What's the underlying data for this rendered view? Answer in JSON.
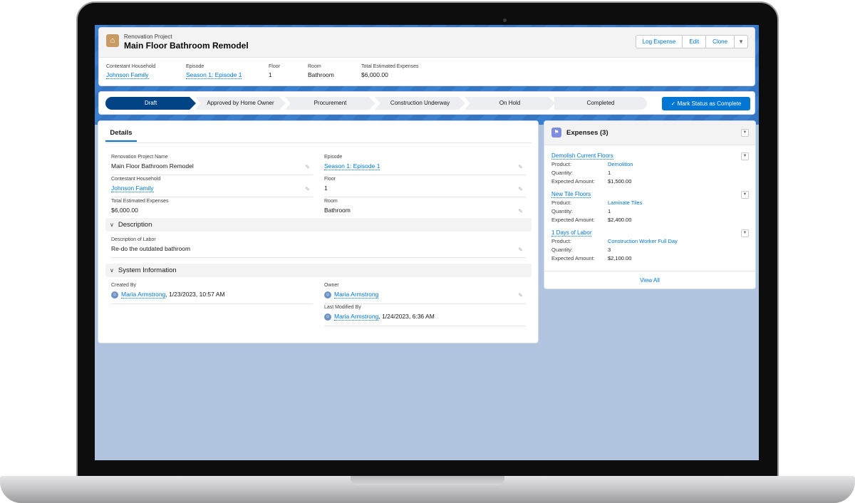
{
  "header": {
    "object_type": "Renovation Project",
    "title": "Main Floor Bathroom Remodel",
    "buttons": [
      "Log Expense",
      "Edit",
      "Clone"
    ],
    "dropdown_icon": "chevron-down-icon",
    "highlights": [
      {
        "label": "Contestant Household",
        "value": "Johnson Family"
      },
      {
        "label": "Episode",
        "value": "Season 1: Episode 1"
      },
      {
        "label": "Floor",
        "value": "1"
      },
      {
        "label": "Room",
        "value": "Bathroom"
      },
      {
        "label": "Total Estimated Expenses",
        "value": "$6,000.00"
      }
    ]
  },
  "path": {
    "stages": [
      "Draft",
      "Approved by Home Owner",
      "Procurement",
      "Construction Underway",
      "On Hold",
      "Completed"
    ],
    "active": "Draft",
    "action_label": "Mark Status as Complete"
  },
  "details": {
    "tab": "Details",
    "fields": [
      {
        "label": "Renovation Project Name",
        "value": "Main Floor Bathroom Remodel"
      },
      {
        "label": "Episode",
        "value": "Season 1: Episode 1"
      },
      {
        "label": "Contestant Household",
        "value": "Johnson Family"
      },
      {
        "label": "Floor",
        "value": "1"
      },
      {
        "label": "Total Estimated Expenses",
        "value": "$6,000.00"
      },
      {
        "label": "Room",
        "value": "Bathroom"
      }
    ],
    "description_section": "Description",
    "description": {
      "label": "Description of Labor",
      "value": "Re-do the outdated bathroom"
    },
    "system_section": "System Information",
    "created_by": {
      "label": "Created By",
      "user": "Maria Armstrong",
      "date": ", 1/23/2023, 10:57 AM"
    },
    "owner": {
      "label": "Owner",
      "user": "Maria Armstrong"
    },
    "last_modified": {
      "label": "Last Modified By",
      "user": "Maria Armstrong",
      "date": ", 1/24/2023, 6:36 AM"
    }
  },
  "expenses": {
    "title": "Expenses (3)",
    "labels": {
      "product": "Product:",
      "quantity": "Quantity:",
      "amount": "Expected Amount:"
    },
    "items": [
      {
        "name": "Demolish Current Floors",
        "product": "Demolition",
        "quantity": "1",
        "amount": "$1,500.00"
      },
      {
        "name": "New Tile Floors",
        "product": "Laminate Tiles",
        "quantity": "1",
        "amount": "$2,400.00"
      },
      {
        "name": "1 Days of Labor",
        "product": "Construction Worker Full Day",
        "quantity": "3",
        "amount": "$2,100.00"
      }
    ],
    "view_all": "View All"
  },
  "colors": {
    "brand": "#0176d3",
    "active_stage": "#014486",
    "background": "#b0c4df"
  }
}
